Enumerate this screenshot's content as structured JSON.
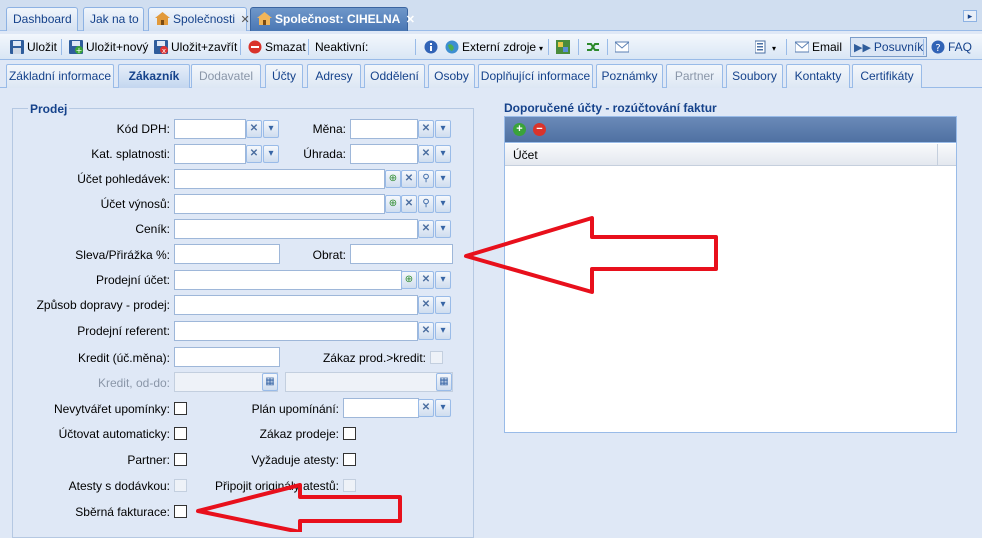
{
  "top_tabs": [
    {
      "label": "Dashboard"
    },
    {
      "label": "Jak na to"
    },
    {
      "label": "Společnosti"
    },
    {
      "label": "Společnost: CIHELNA"
    }
  ],
  "toolbar": {
    "save": "Uložit",
    "save_new": "Uložit+nový",
    "save_close": "Uložit+zavřít",
    "delete": "Smazat",
    "inactive": "Neaktivní:",
    "external": "Externí zdroje",
    "email": "Email",
    "posuvnik": "Posuvník",
    "faq": "FAQ"
  },
  "sub_tabs": [
    {
      "label": "Základní informace"
    },
    {
      "label": "Zákazník"
    },
    {
      "label": "Dodavatel"
    },
    {
      "label": "Účty"
    },
    {
      "label": "Adresy"
    },
    {
      "label": "Oddělení"
    },
    {
      "label": "Osoby"
    },
    {
      "label": "Doplňující informace"
    },
    {
      "label": "Poznámky"
    },
    {
      "label": "Partner"
    },
    {
      "label": "Soubory"
    },
    {
      "label": "Kontakty"
    },
    {
      "label": "Certifikáty"
    }
  ],
  "prodej": {
    "legend": "Prodej",
    "kod_dph": "Kód DPH:",
    "mena": "Měna:",
    "kat_splatnosti": "Kat. splatnosti:",
    "uhrada": "Úhrada:",
    "ucet_pohledavek": "Účet pohledávek:",
    "ucet_vynosu": "Účet výnosů:",
    "cenik": "Ceník:",
    "sleva": "Sleva/Přirážka %:",
    "obrat": "Obrat:",
    "prodejni_ucet": "Prodejní účet:",
    "zpusob_dopravy": "Způsob dopravy - prodej:",
    "prodejni_referent": "Prodejní referent:",
    "kredit": "Kredit (úč.měna):",
    "zakaz_prod_kredit": "Zákaz prod.>kredit:",
    "kredit_od_do": "Kredit, od-do:",
    "nevytvaret_upominky": "Nevytvářet upomínky:",
    "plan_upominani": "Plán upomínání:",
    "uctovat_automaticky": "Účtovat automaticky:",
    "zakaz_prodeje": "Zákaz prodeje:",
    "partner": "Partner:",
    "vyzaduje_atesty": "Vyžaduje atesty:",
    "atesty_s_dodavkou": "Atesty s dodávkou:",
    "pripojit_originaly": "Připojit originály atestů:",
    "sberna_fakturace": "Sběrná fakturace:"
  },
  "grid": {
    "title": "Doporučené účty - rozúčtování faktur",
    "column": "Účet"
  },
  "colors": {
    "accent": "#15428b",
    "arrow": "#e8101c"
  }
}
